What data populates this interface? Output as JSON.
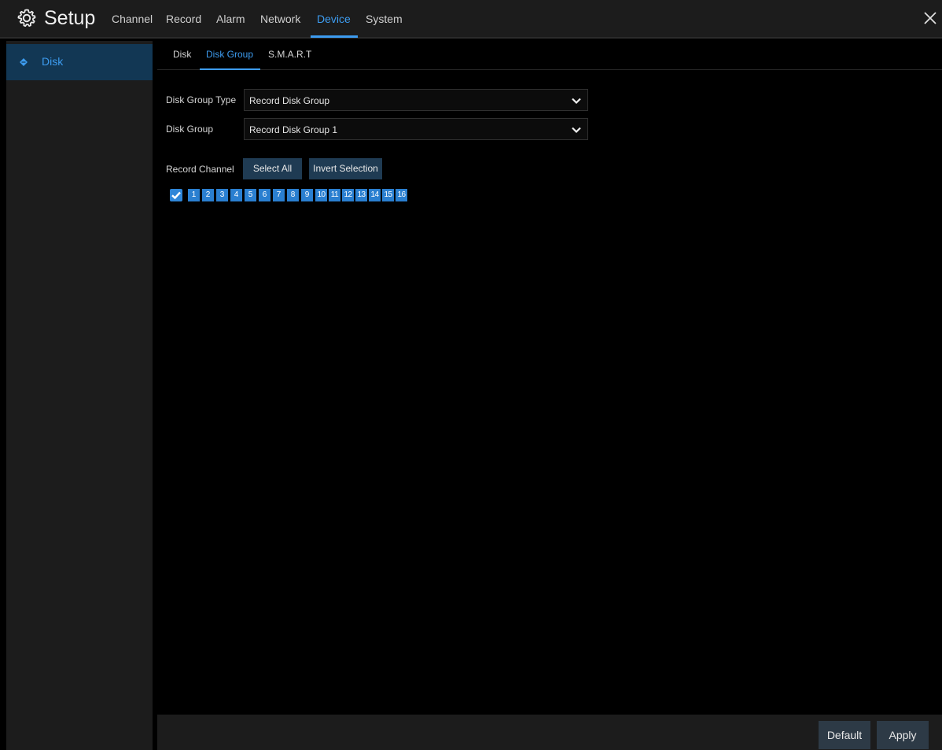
{
  "header": {
    "title": "Setup",
    "tabs": [
      {
        "label": "Channel"
      },
      {
        "label": "Record"
      },
      {
        "label": "Alarm"
      },
      {
        "label": "Network"
      },
      {
        "label": "Device"
      },
      {
        "label": "System"
      }
    ],
    "active_tab": "Device"
  },
  "sidebar": {
    "items": [
      {
        "label": "Disk"
      }
    ]
  },
  "subtabs": [
    {
      "label": "Disk"
    },
    {
      "label": "Disk Group"
    },
    {
      "label": "S.M.A.R.T"
    }
  ],
  "form": {
    "disk_group_type": {
      "label": "Disk Group Type",
      "value": "Record Disk Group"
    },
    "disk_group": {
      "label": "Disk Group",
      "value": "Record Disk Group 1"
    },
    "record_channel": {
      "label": "Record Channel",
      "select_all": "Select All",
      "invert_selection": "Invert Selection",
      "all_checked": true,
      "channels": [
        "1",
        "2",
        "3",
        "4",
        "5",
        "6",
        "7",
        "8",
        "9",
        "10",
        "11",
        "12",
        "13",
        "14",
        "15",
        "16"
      ]
    }
  },
  "footer": {
    "default_label": "Default",
    "apply_label": "Apply"
  },
  "colors": {
    "accent": "#3d9cf0",
    "chip": "#2a7fd0",
    "sidebar_active": "#123754"
  }
}
